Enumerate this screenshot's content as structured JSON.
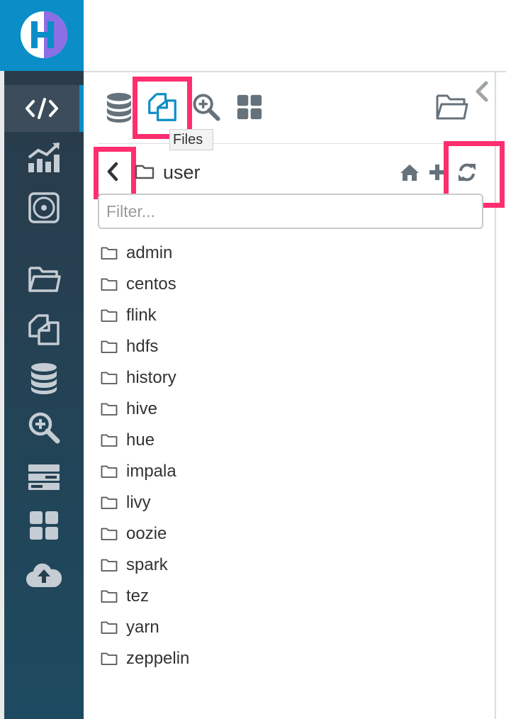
{
  "sidebar": {
    "logo_letter": "H",
    "items": [
      {
        "name": "editor",
        "icon": "code-icon",
        "active": true
      },
      {
        "name": "dashboard",
        "icon": "chart-icon",
        "active": false
      },
      {
        "name": "scheduler",
        "icon": "target-icon",
        "active": false
      },
      {
        "name": "documents",
        "icon": "folder-open-icon",
        "active": false
      },
      {
        "name": "files",
        "icon": "files-icon",
        "active": false
      },
      {
        "name": "tables",
        "icon": "database-icon",
        "active": false
      },
      {
        "name": "jobs",
        "icon": "search-plus-icon",
        "active": false
      },
      {
        "name": "servers",
        "icon": "server-icon",
        "active": false
      },
      {
        "name": "apps",
        "icon": "grid-icon",
        "active": false
      },
      {
        "name": "importer",
        "icon": "cloud-upload-icon",
        "active": false
      }
    ]
  },
  "assist": {
    "tabs": [
      {
        "name": "sql",
        "icon": "database-icon"
      },
      {
        "name": "files",
        "icon": "files-icon",
        "active": true
      },
      {
        "name": "jobs",
        "icon": "search-plus-icon"
      },
      {
        "name": "apps",
        "icon": "grid-icon"
      }
    ],
    "tooltip": "Files",
    "path": "user",
    "filter_placeholder": "Filter...",
    "folders": [
      "admin",
      "centos",
      "flink",
      "hdfs",
      "history",
      "hive",
      "hue",
      "impala",
      "livy",
      "oozie",
      "spark",
      "tez",
      "yarn",
      "zeppelin"
    ]
  },
  "colors": {
    "brand": "#0b8ec7",
    "highlight": "#ff2e6e",
    "sidebar": "#263e4e",
    "active_icon": "#0b8ec7"
  }
}
